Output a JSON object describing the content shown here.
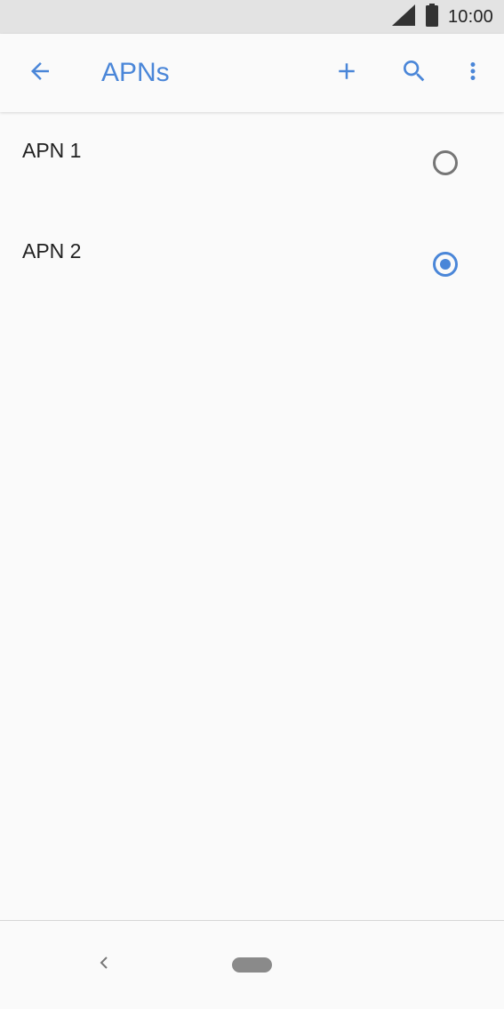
{
  "status_bar": {
    "time": "10:00",
    "signal_icon": "signal-icon",
    "battery_icon": "battery-icon"
  },
  "app_bar": {
    "title": "APNs",
    "back_icon": "arrow-back-icon",
    "add_icon": "add-icon",
    "search_icon": "search-icon",
    "more_icon": "more-vert-icon"
  },
  "apn_list": {
    "items": [
      {
        "label": "APN 1",
        "selected": false
      },
      {
        "label": "APN 2",
        "selected": true
      }
    ]
  },
  "nav_bar": {
    "back_icon": "nav-back-icon",
    "home_icon": "home-pill-icon"
  },
  "colors": {
    "accent": "#4a86d8",
    "status_bar_bg": "#e3e3e3",
    "background": "#fafafa",
    "text_primary": "#212121",
    "radio_unchecked": "#757575"
  }
}
